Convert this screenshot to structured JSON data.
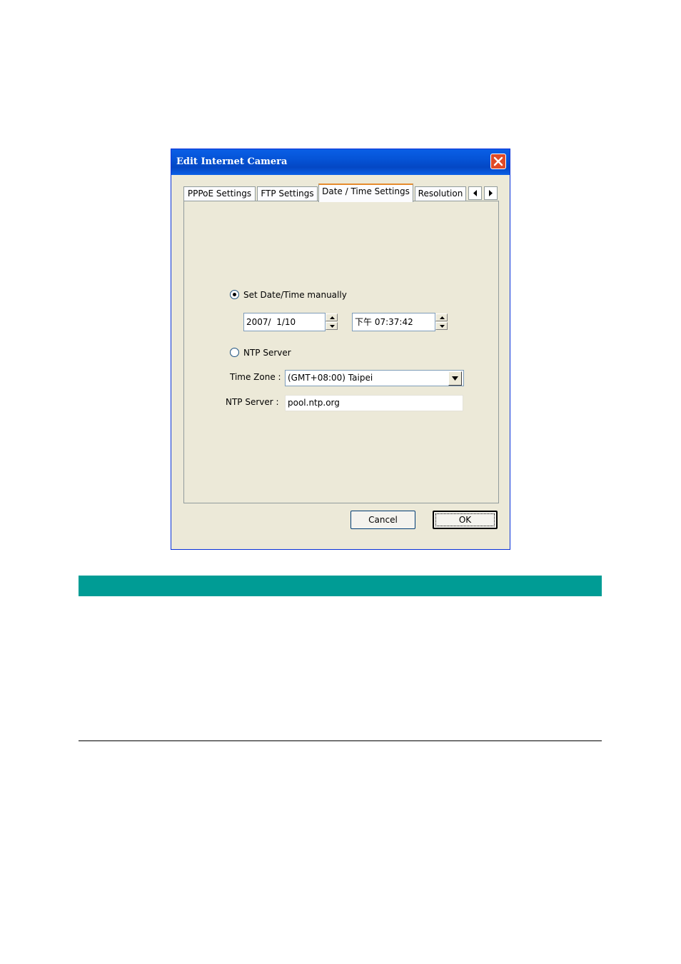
{
  "window": {
    "title": "Edit Internet Camera",
    "close_icon": "close-icon"
  },
  "tabs": [
    {
      "label": "PPPoE Settings",
      "active": false
    },
    {
      "label": "FTP Settings",
      "active": false
    },
    {
      "label": "Date / Time Settings",
      "active": true
    },
    {
      "label": "Resolution",
      "active": false
    }
  ],
  "tab_scroll": {
    "left_icon": "arrow-left-icon",
    "right_icon": "arrow-right-icon"
  },
  "datetime": {
    "manual_label": "Set Date/Time manually",
    "manual_selected": true,
    "date_value": "2007/  1/10",
    "time_value": "下午 07:37:42",
    "ntp_label": "NTP Server",
    "ntp_selected": false,
    "timezone_label": "Time Zone :",
    "timezone_value": "(GMT+08:00) Taipei",
    "ntp_server_label": "NTP Server :",
    "ntp_server_value": "pool.ntp.org"
  },
  "buttons": {
    "cancel_label": "Cancel",
    "ok_label": "OK"
  },
  "colors": {
    "titlebar": "#0553d6",
    "dialog_bg": "#ece9d8",
    "teal_bar": "#009c95"
  }
}
